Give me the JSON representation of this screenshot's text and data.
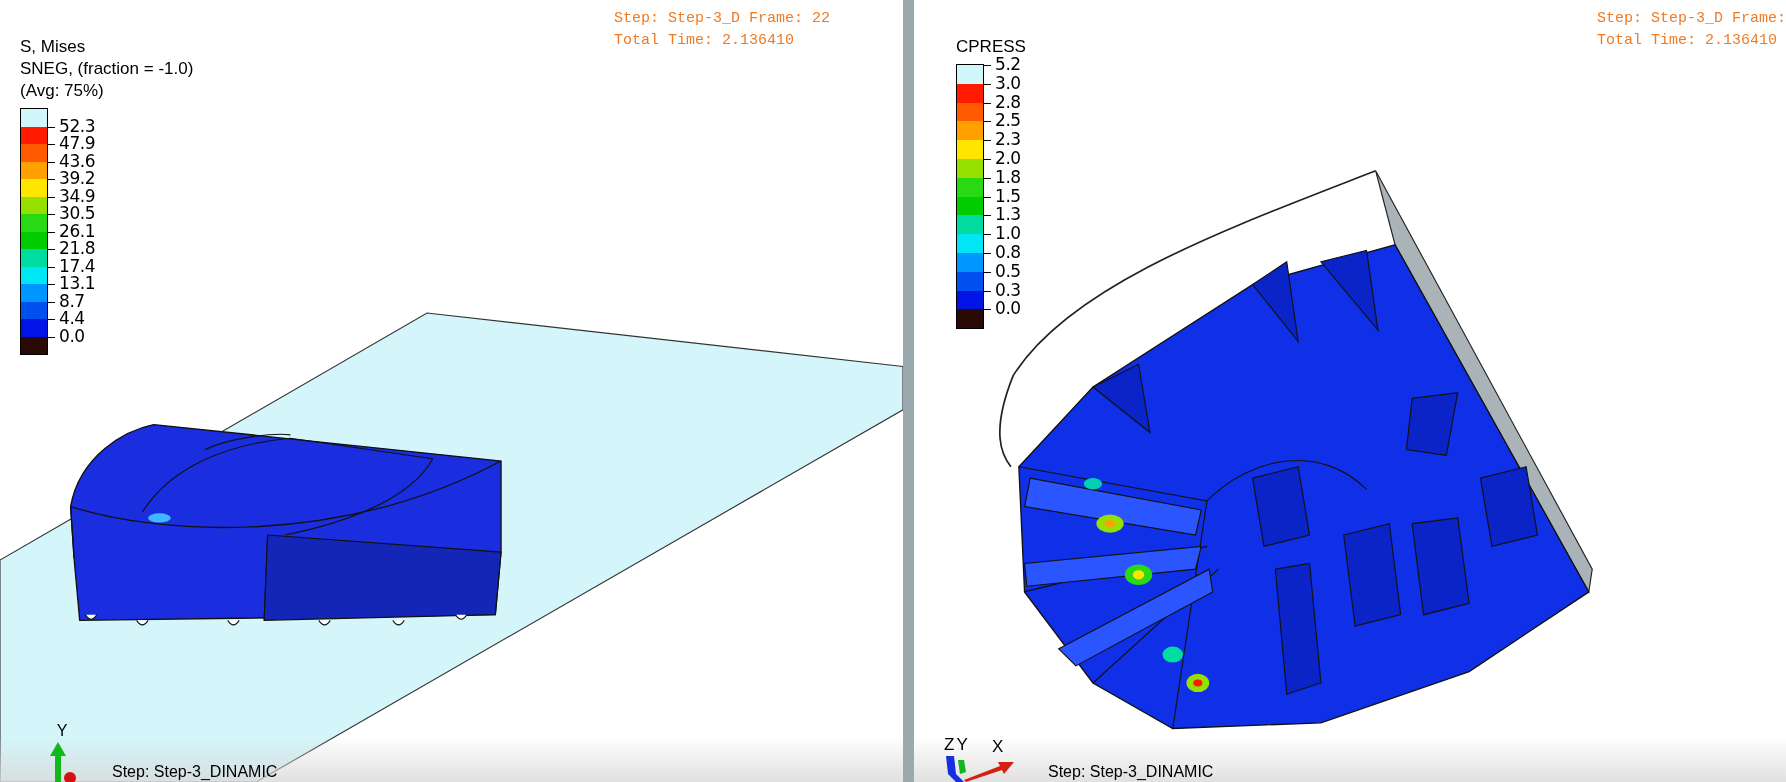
{
  "viewports": [
    {
      "kind": "contact-block",
      "header": [
        "Step: Step-3_D Frame: 22",
        "Total Time: 2.136410"
      ],
      "legend": {
        "title": [
          "S, Mises",
          "SNEG, (fraction = -1.0)",
          "(Avg: 75%)"
        ],
        "bands": [
          {
            "color": "#d2f7fa"
          },
          {
            "color": "#ff1a00",
            "label": "52.3"
          },
          {
            "color": "#ff5a00",
            "label": "47.9"
          },
          {
            "color": "#ffa000",
            "label": "43.6"
          },
          {
            "color": "#ffe600",
            "label": "39.2"
          },
          {
            "color": "#96e000",
            "label": "34.9"
          },
          {
            "color": "#28d914",
            "label": "30.5"
          },
          {
            "color": "#00cc00",
            "label": "26.1"
          },
          {
            "color": "#00dca0",
            "label": "21.8"
          },
          {
            "color": "#00e6f5",
            "label": "17.4"
          },
          {
            "color": "#0096ff",
            "label": "13.1"
          },
          {
            "color": "#0050f0",
            "label": "8.7"
          },
          {
            "color": "#0014e6",
            "label": "4.4"
          },
          {
            "color": "#2a0a05",
            "label": "0.0"
          }
        ]
      },
      "triad": {
        "kind": "y-up",
        "axes": [
          "Y"
        ]
      },
      "footer": "Step: Step-3_DINAMIC"
    },
    {
      "kind": "tread-contact",
      "header": [
        "Step: Step-3_D Frame:",
        "Total Time: 2.136410"
      ],
      "legend": {
        "title": [
          "CPRESS"
        ],
        "bands": [
          {
            "color": "#d2f7fa",
            "label": "5.2"
          },
          {
            "color": "#ff1a00",
            "label": "3.0"
          },
          {
            "color": "#ff5a00",
            "label": "2.8"
          },
          {
            "color": "#ffa000",
            "label": "2.5"
          },
          {
            "color": "#ffe600",
            "label": "2.3"
          },
          {
            "color": "#96e000",
            "label": "2.0"
          },
          {
            "color": "#28d914",
            "label": "1.8"
          },
          {
            "color": "#00cc00",
            "label": "1.5"
          },
          {
            "color": "#00dca0",
            "label": "1.3"
          },
          {
            "color": "#00e6f5",
            "label": "1.0"
          },
          {
            "color": "#0096ff",
            "label": "0.8"
          },
          {
            "color": "#0050f0",
            "label": "0.5"
          },
          {
            "color": "#0014e6",
            "label": "0.3"
          },
          {
            "color": "#2a0a05",
            "label": "0.0"
          }
        ]
      },
      "triad": {
        "kind": "zyx",
        "axes": [
          "Z",
          "Y",
          "X"
        ]
      },
      "footer": "Step: Step-3_DINAMIC"
    }
  ]
}
